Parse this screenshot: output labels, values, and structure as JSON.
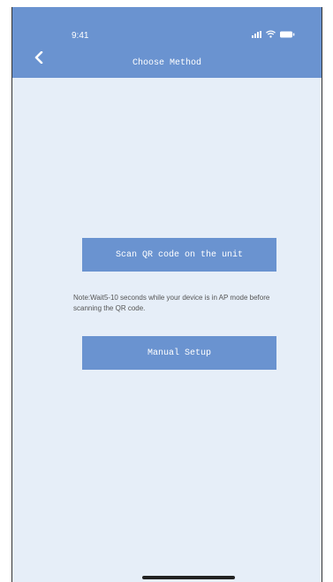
{
  "status_bar": {
    "time": "9:41",
    "icons": [
      "signal-icon",
      "wifi-icon",
      "battery-icon"
    ]
  },
  "nav": {
    "back_icon": "chevron-left-icon",
    "title": "Choose Method"
  },
  "main": {
    "scan_button_label": "Scan QR code on the unit",
    "note": "Note:Wait5-10 seconds while your device is in AP mode before scanning the QR code.",
    "manual_button_label": "Manual Setup"
  },
  "colors": {
    "accent": "#6a93d0",
    "background": "#e6eef8",
    "note_text": "#555555"
  }
}
